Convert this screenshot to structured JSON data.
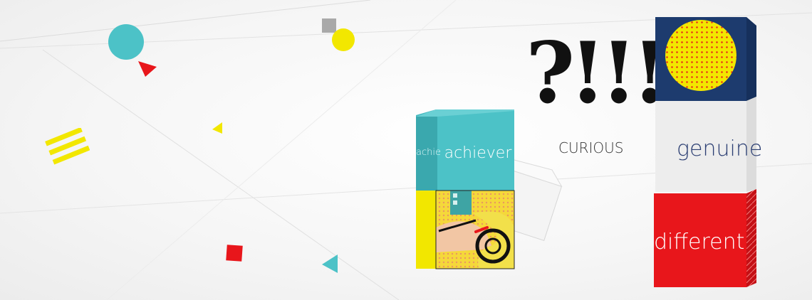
{
  "banner": {
    "words": {
      "achiever_front": "achiever",
      "achiever_side": "achiever",
      "curious": "CURIOUS",
      "question_marks": "?!!!",
      "genuine": "genuine",
      "different": "different"
    },
    "colors": {
      "teal": "#4cc2c7",
      "yellow": "#f2e700",
      "red": "#e8161b",
      "navy": "#1d3b6e",
      "gray": "#a9a9a9",
      "white_cube": "#f1f1f1"
    }
  }
}
